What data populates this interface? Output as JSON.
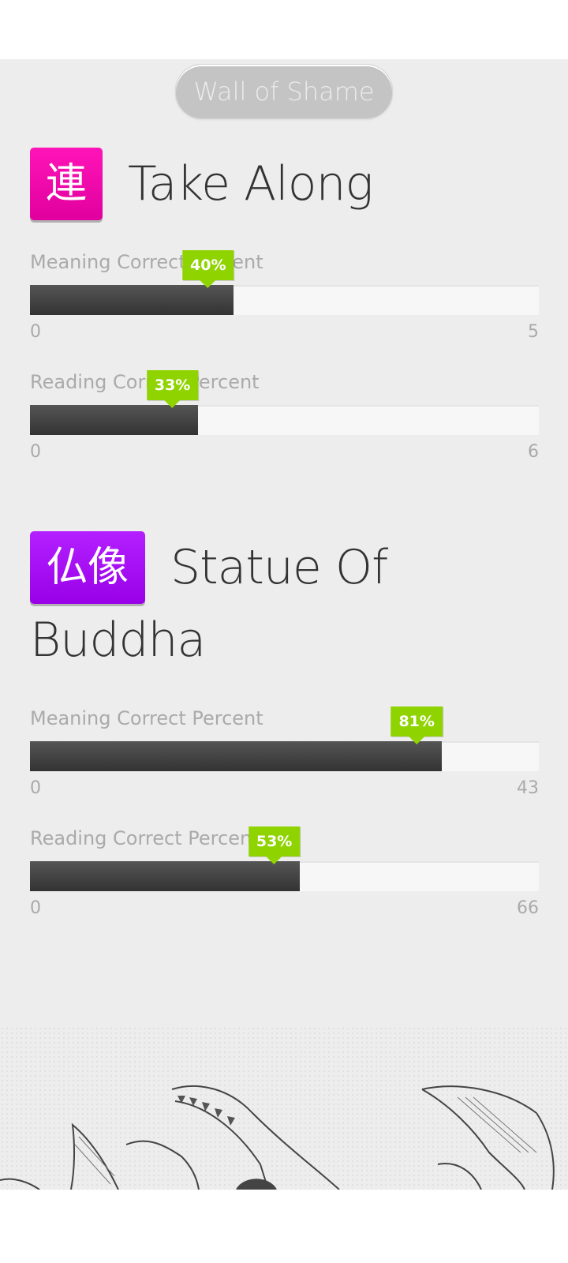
{
  "wall_button": "Wall of Shame",
  "items": [
    {
      "kanji": "連",
      "meaning": "Take Along",
      "color": "#ff00aa",
      "stats": [
        {
          "label": "Meaning Correct Percent",
          "percent_label": "40%",
          "percent": 40,
          "min": "0",
          "max": "5"
        },
        {
          "label": "Reading Correct Percent",
          "percent_label": "33%",
          "percent": 33,
          "min": "0",
          "max": "6"
        }
      ]
    },
    {
      "kanji": "仏像",
      "meaning": "Statue Of Buddha",
      "color": "#aa00ff",
      "stats": [
        {
          "label": "Meaning Correct Percent",
          "percent_label": "81%",
          "percent": 81,
          "min": "0",
          "max": "43"
        },
        {
          "label": "Reading Correct Percent",
          "percent_label": "53%",
          "percent": 53,
          "min": "0",
          "max": "66"
        }
      ]
    }
  ],
  "colors": {
    "tooltip": "#8fd400",
    "bar_fill": "#3f3f3f",
    "background": "#ededed"
  },
  "illustration": "crocodile-illustration"
}
